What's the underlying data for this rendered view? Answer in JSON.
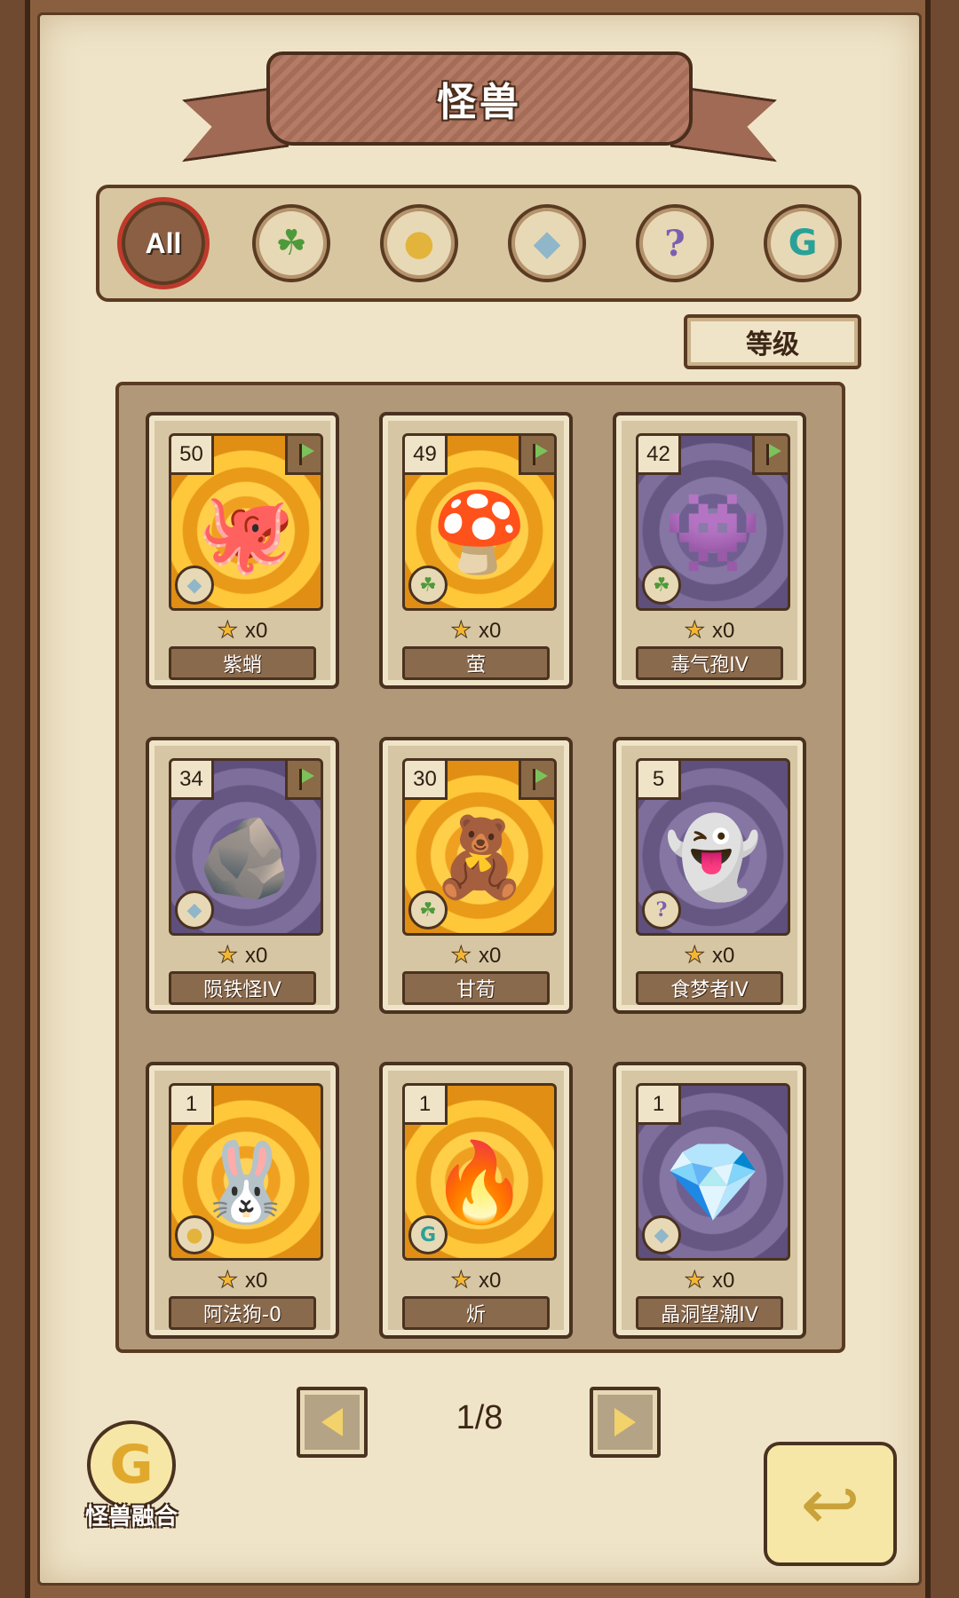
{
  "header": {
    "title": "怪兽"
  },
  "filters": [
    {
      "id": "all",
      "label": "All",
      "icon": "all-icon",
      "active": true
    },
    {
      "id": "plant",
      "icon": "leaf-icon"
    },
    {
      "id": "beast",
      "icon": "paw-icon"
    },
    {
      "id": "mineral",
      "icon": "crystal-icon"
    },
    {
      "id": "mystery",
      "icon": "question-icon"
    },
    {
      "id": "special",
      "icon": "swirl-icon"
    }
  ],
  "sort": {
    "label": "等级"
  },
  "cards": [
    {
      "level": "50",
      "name": "紫蛸",
      "stars": "x0",
      "art": "gold",
      "type_icon": "crystal-icon",
      "flag": true
    },
    {
      "level": "49",
      "name": "萤",
      "stars": "x0",
      "art": "gold",
      "type_icon": "leaf-icon",
      "flag": true
    },
    {
      "level": "42",
      "name": "毒气孢IV",
      "stars": "x0",
      "art": "purple",
      "type_icon": "leaf-icon",
      "flag": true
    },
    {
      "level": "34",
      "name": "陨铁怪IV",
      "stars": "x0",
      "art": "purple",
      "type_icon": "crystal-icon",
      "flag": true
    },
    {
      "level": "30",
      "name": "甘荀",
      "stars": "x0",
      "art": "gold",
      "type_icon": "leaf-icon",
      "flag": true
    },
    {
      "level": "5",
      "name": "食梦者IV",
      "stars": "x0",
      "art": "purple",
      "type_icon": "question-icon",
      "flag": false
    },
    {
      "level": "1",
      "name": "阿法狗-0",
      "stars": "x0",
      "art": "gold",
      "type_icon": "paw-icon",
      "flag": false
    },
    {
      "level": "1",
      "name": "炘",
      "stars": "x0",
      "art": "gold",
      "type_icon": "swirl-icon",
      "flag": false
    },
    {
      "level": "1",
      "name": "晶洞望潮IV",
      "stars": "x0",
      "art": "purple",
      "type_icon": "crystal-icon",
      "flag": false
    }
  ],
  "pagination": {
    "current": "1/8"
  },
  "fusion": {
    "label": "怪兽融合"
  },
  "colors": {
    "accent": "#c0392b",
    "gold_art": "#ffc83a",
    "purple_art": "#7e6e9c",
    "name_plate": "#8a6a4c"
  }
}
